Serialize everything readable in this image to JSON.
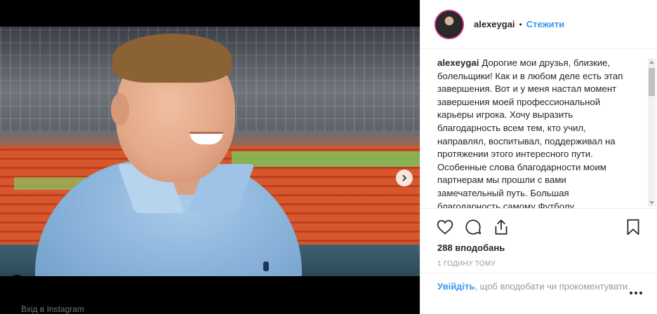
{
  "post": {
    "username": "alexeygai",
    "separator": "•",
    "follow_label": "Стежити",
    "caption_user": "alexeygai",
    "caption_text": "Дорогие мои друзья, близкие, болельщики! Как и в любом деле есть этап завершения. Вот и у меня настал момент завершения моей профессиональной карьеры игрока. Хочу выразить благодарность всем тем, кто учил, направлял, воспитывал, поддерживал на протяжении этого интересного пути. Особенные слова благодарности моим партнерам мы прошли с вами замечательный путь. Большая благодарность самому Футболу.",
    "likes": "288 вподобань",
    "time": "1 годину тому",
    "login_label": "Увійдіть",
    "login_suffix": ", щоб вподобати чи прокоментувати."
  },
  "media": {
    "slide_count": 9,
    "active_slide": 1
  },
  "bottom_bar": {
    "text": "Вхід в Instagram"
  },
  "icons": {
    "like": "heart-icon",
    "comment": "comment-icon",
    "share": "share-icon",
    "save": "bookmark-icon",
    "next": "chevron-right-icon",
    "user_tag": "user-icon",
    "more": "more-options-icon"
  },
  "colors": {
    "accent": "#3897f0",
    "text": "#262626",
    "muted": "#999999",
    "story_ring": "#c13584"
  }
}
